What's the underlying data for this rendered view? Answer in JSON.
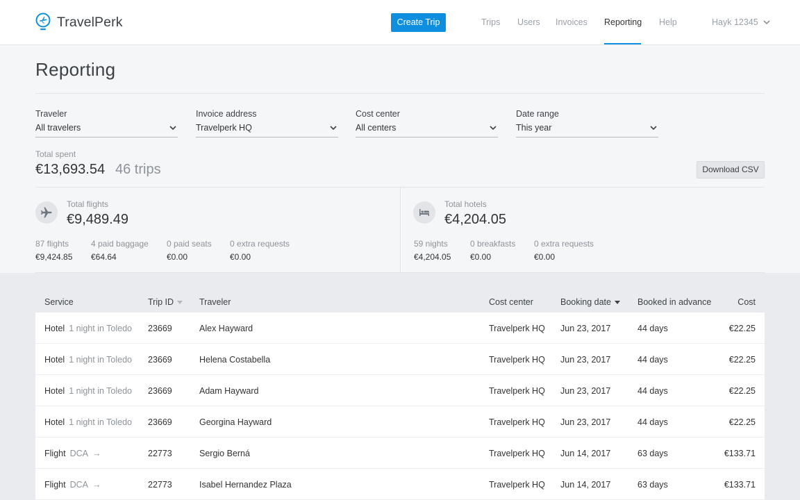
{
  "brand": {
    "name": "TravelPerk",
    "color": "#0d8ede"
  },
  "nav": {
    "create_trip": "Create Trip",
    "links": [
      {
        "label": "Trips",
        "active": false
      },
      {
        "label": "Users",
        "active": false
      },
      {
        "label": "Invoices",
        "active": false
      },
      {
        "label": "Reporting",
        "active": true
      },
      {
        "label": "Help",
        "active": false
      }
    ],
    "user": "Hayk 12345",
    "user_icon": "chevron-down-icon"
  },
  "page": {
    "title": "Reporting"
  },
  "filters": [
    {
      "label": "Traveler",
      "value": "All travelers"
    },
    {
      "label": "Invoice address",
      "value": "Travelperk HQ"
    },
    {
      "label": "Cost center",
      "value": "All centers"
    },
    {
      "label": "Date range",
      "value": "This year"
    }
  ],
  "totals": {
    "label": "Total spent",
    "amount": "€13,693.54",
    "trips": "46 trips",
    "download": "Download CSV"
  },
  "flights": {
    "icon": "airplane-icon",
    "label": "Total flights",
    "amount": "€9,489.49",
    "stats": [
      {
        "label": "87 flights",
        "value": "€9,424.85"
      },
      {
        "label": "4 paid baggage",
        "value": "€64.64"
      },
      {
        "label": "0 paid seats",
        "value": "€0.00"
      },
      {
        "label": "0 extra requests",
        "value": "€0.00"
      }
    ]
  },
  "hotels": {
    "icon": "bed-icon",
    "label": "Total hotels",
    "amount": "€4,204.05",
    "stats": [
      {
        "label": "59 nights",
        "value": "€4,204.05"
      },
      {
        "label": "0 breakfasts",
        "value": "€0.00"
      },
      {
        "label": "0 extra requests",
        "value": "€0.00"
      }
    ]
  },
  "table": {
    "headers": {
      "service": "Service",
      "trip_id": "Trip ID",
      "traveler": "Traveler",
      "cost_center": "Cost center",
      "booking_date": "Booking date",
      "advance": "Booked in advance",
      "cost": "Cost"
    },
    "rows": [
      {
        "service": "Hotel",
        "detail": "1 night in Toledo",
        "arrow": "",
        "trip_id": "23669",
        "traveler": "Alex Hayward",
        "cost_center": "Travelperk HQ",
        "booking_date": "Jun 23, 2017",
        "advance": "44 days",
        "cost": "€22.25"
      },
      {
        "service": "Hotel",
        "detail": "1 night in Toledo",
        "arrow": "",
        "trip_id": "23669",
        "traveler": "Helena Costabella",
        "cost_center": "Travelperk HQ",
        "booking_date": "Jun 23, 2017",
        "advance": "44 days",
        "cost": "€22.25"
      },
      {
        "service": "Hotel",
        "detail": "1 night in Toledo",
        "arrow": "",
        "trip_id": "23669",
        "traveler": "Adam Hayward",
        "cost_center": "Travelperk HQ",
        "booking_date": "Jun 23, 2017",
        "advance": "44 days",
        "cost": "€22.25"
      },
      {
        "service": "Hotel",
        "detail": "1 night in Toledo",
        "arrow": "",
        "trip_id": "23669",
        "traveler": "Georgina Hayward",
        "cost_center": "Travelperk HQ",
        "booking_date": "Jun 23, 2017",
        "advance": "44 days",
        "cost": "€22.25"
      },
      {
        "service": "Flight",
        "detail": "DCA",
        "arrow": "→",
        "trip_id": "22773",
        "traveler": "Sergio Berná",
        "cost_center": "Travelperk HQ",
        "booking_date": "Jun 14, 2017",
        "advance": "63 days",
        "cost": "€133.71"
      },
      {
        "service": "Flight",
        "detail": "DCA",
        "arrow": "→",
        "trip_id": "22773",
        "traveler": "Isabel Hernandez Plaza",
        "cost_center": "Travelperk HQ",
        "booking_date": "Jun 14, 2017",
        "advance": "63 days",
        "cost": "€133.71"
      }
    ]
  }
}
